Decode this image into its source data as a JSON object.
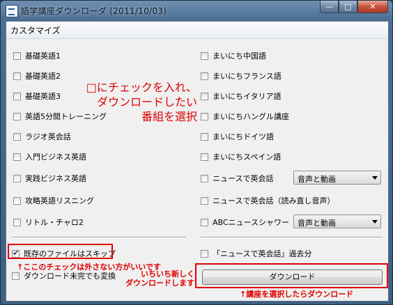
{
  "window": {
    "title": "語学講座ダウンローダ (2011/10/03)"
  },
  "menu": {
    "item": "カスタマイズ"
  },
  "left_courses": [
    "基礎英語1",
    "基礎英語2",
    "基礎英語3",
    "英語5分間トレーニング",
    "ラジオ英会話",
    "入門ビジネス英語",
    "実践ビジネス英語",
    "攻略英語リスニング",
    "リトル・チャロ2"
  ],
  "right_courses": [
    "まいにち中国語",
    "まいにちフランス語",
    "まいにちイタリア語",
    "まいにちハングル講座",
    "まいにちドイツ語",
    "まいにちスペイン語",
    "ニュースで英会話",
    "ニュースで英会話（読み直し音声）",
    "ABCニュースシャワー"
  ],
  "combos": {
    "news": "音声と動画",
    "abc": "音声と動画"
  },
  "options": {
    "skip_existing": "既存のファイルはスキップ",
    "convert_incomplete": "ダウンロード未完でも変換",
    "news_past": "「ニュースで英会話」過去分"
  },
  "buttons": {
    "download": "ダウンロード"
  },
  "annotations": {
    "select_line1": "□にチェックを入れ、",
    "select_line2": "ダウンロードしたい",
    "select_line3": "番組を選択",
    "skip_note": "↑ここのチェックは外さない方がいいです",
    "redownload_line1": "いちいち新しく",
    "redownload_line2": "ダウンロードします",
    "download_note": "↑講座を選択したらダウンロード"
  },
  "colors": {
    "annotation": "#e00000"
  }
}
